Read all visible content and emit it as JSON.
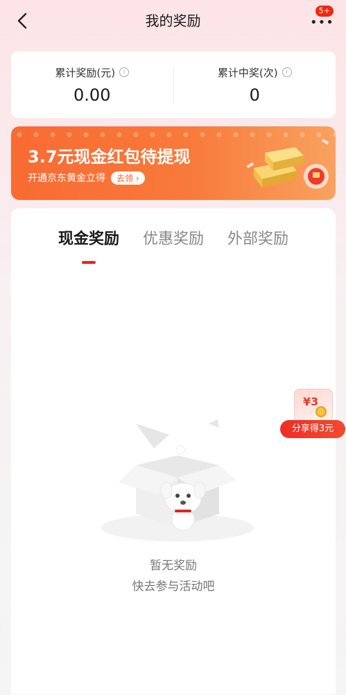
{
  "header": {
    "title": "我的奖励",
    "badge": "5+"
  },
  "stats": [
    {
      "label": "累计奖励(元)",
      "value": "0.00"
    },
    {
      "label": "累计中奖(次)",
      "value": "0"
    }
  ],
  "promo": {
    "title": "3.7元现金红包待提现",
    "subtitle": "开通京东黄金立得",
    "button": "去领 ›"
  },
  "tabs": [
    {
      "label": "现金奖励",
      "active": true
    },
    {
      "label": "优惠奖励",
      "active": false
    },
    {
      "label": "外部奖励",
      "active": false
    }
  ],
  "empty": {
    "title": "暂无奖励",
    "subtitle": "快去参与活动吧"
  },
  "share_float": {
    "envelope_text": "¥3",
    "label": "分享得3元"
  },
  "colors": {
    "accent": "#e1251b",
    "promo_start": "#f86b33",
    "promo_end": "#f9a25f"
  },
  "icons": {
    "back": "chevron-left-icon",
    "more": "more-dots-icon",
    "info": "info-icon"
  }
}
